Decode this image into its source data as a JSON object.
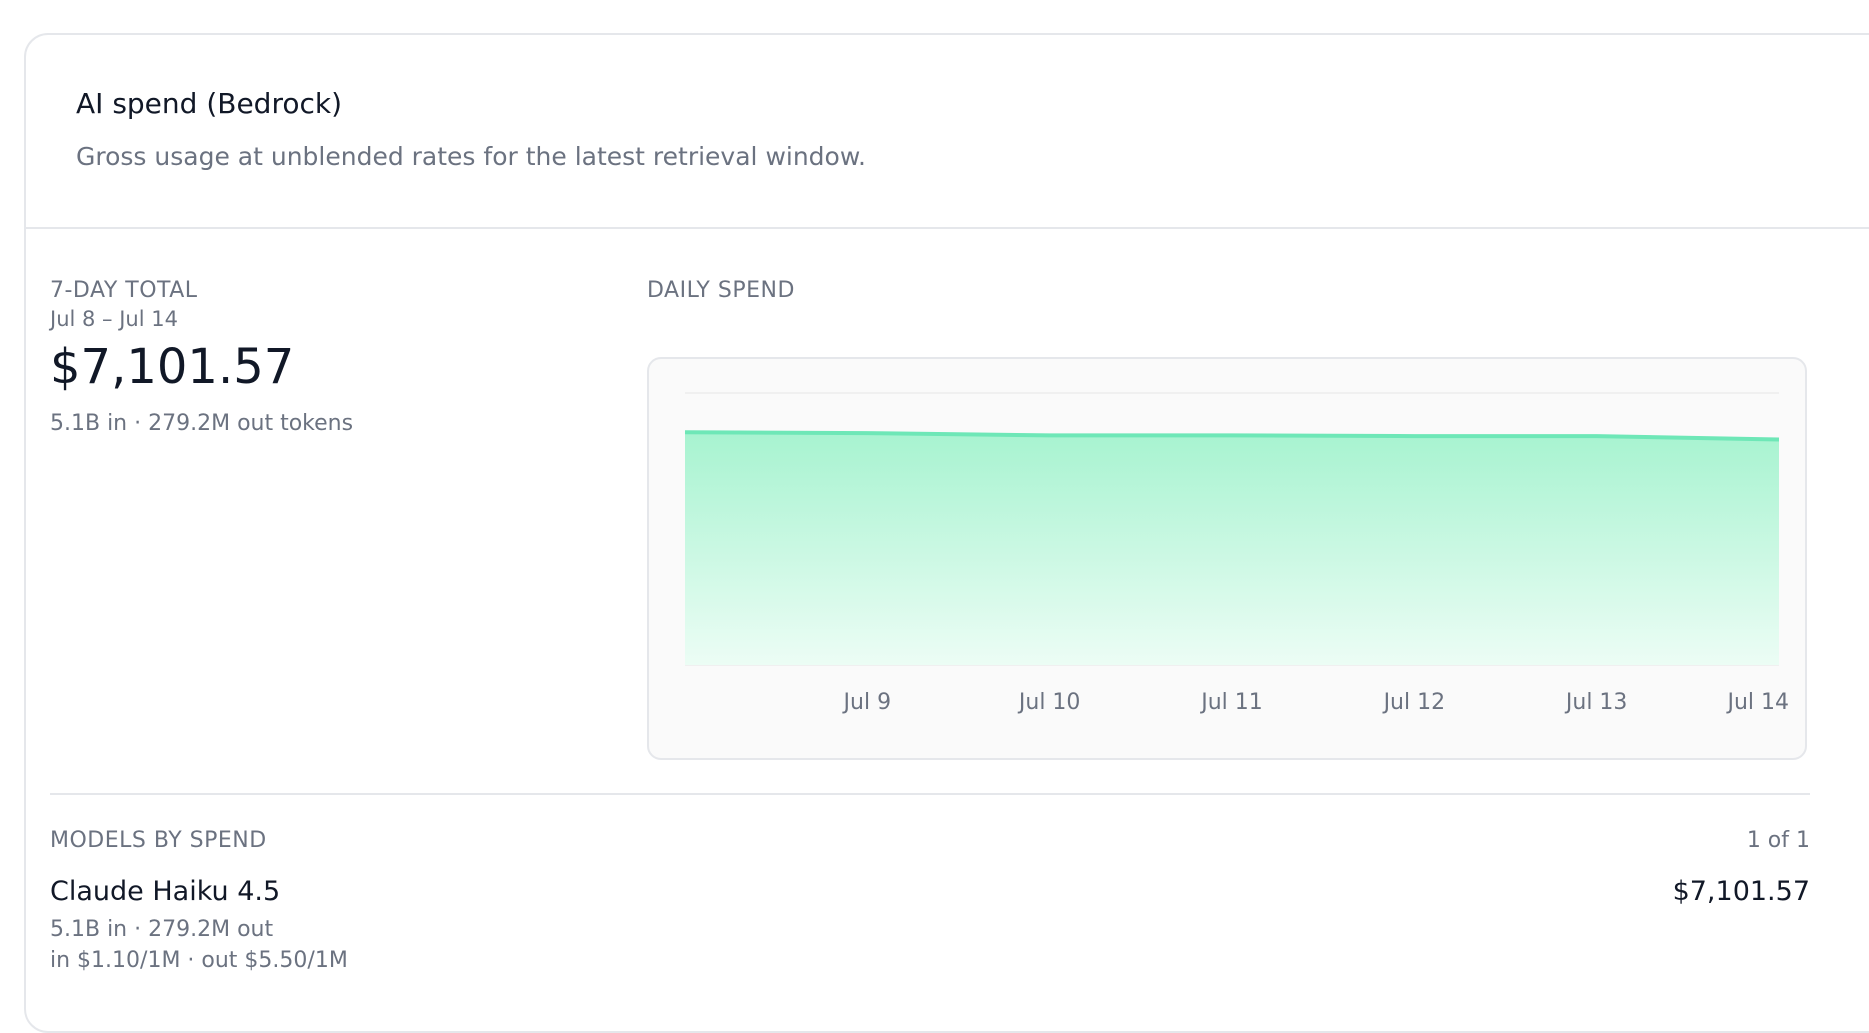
{
  "header": {
    "title": "AI spend (Bedrock)",
    "subtitle": "Gross usage at unblended rates for the latest retrieval window."
  },
  "summary": {
    "label": "7-DAY TOTAL",
    "range": "Jul 8 – Jul 14",
    "total": "$7,101.57",
    "tokens": "5.1B in · 279.2M out tokens"
  },
  "daily": {
    "label": "DAILY SPEND"
  },
  "chart_data": {
    "type": "area",
    "categories": [
      "Jul 8",
      "Jul 9",
      "Jul 10",
      "Jul 11",
      "Jul 12",
      "Jul 13",
      "Jul 14"
    ],
    "x_tick_labels": [
      "Jul 9",
      "Jul 10",
      "Jul 11",
      "Jul 12",
      "Jul 13",
      "Jul 14"
    ],
    "values": [
      1027,
      1023,
      1013,
      1013,
      1010,
      1010,
      995
    ],
    "ylim": [
      0,
      1200
    ],
    "grid": true,
    "colors": {
      "line": "#6ee7b7",
      "fill_top": "#a7f3d0",
      "fill_bottom": "#ecfdf5",
      "grid": "#ececec"
    }
  },
  "models": {
    "label": "MODELS BY SPEND",
    "pager": "1 of 1",
    "items": [
      {
        "name": "Claude Haiku 4.5",
        "spend": "$7,101.57",
        "tokens": "5.1B in · 279.2M out",
        "rates": "in $1.10/1M · out $5.50/1M"
      }
    ]
  }
}
